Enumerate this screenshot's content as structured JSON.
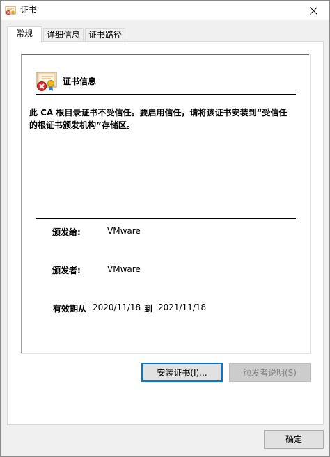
{
  "window": {
    "title": "证书",
    "close_icon": "close-icon"
  },
  "tabs": [
    {
      "label": "常规",
      "active": true
    },
    {
      "label": "详细信息",
      "active": false
    },
    {
      "label": "证书路径",
      "active": false
    }
  ],
  "general": {
    "header": "证书信息",
    "warning": "此 CA 根目录证书不受信任。要启用信任，请将该证书安装到“受信任的根证书颁发机构”存储区。",
    "issued_to_label": "颁发给:",
    "issued_to_value": "VMware",
    "issued_by_label": "颁发者:",
    "issued_by_value": "VMware",
    "validity_label": "有效期从",
    "valid_from": "2020/11/18",
    "valid_to_label": "到",
    "valid_to": "2021/11/18"
  },
  "buttons": {
    "install": "安装证书(I)...",
    "issuer_statement": "颁发者说明(S)",
    "ok": "确定"
  },
  "colors": {
    "focus_border": "#0078d7",
    "disabled_text": "#838383",
    "error_red": "#d92b2b"
  }
}
